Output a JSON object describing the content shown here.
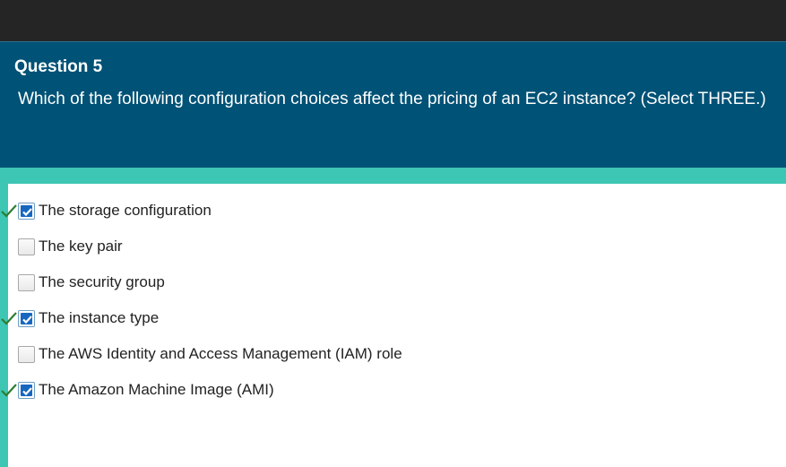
{
  "question": {
    "number_label": "Question 5",
    "text": "Which of the following configuration choices affect the pricing of an EC2 instance? (Select THREE.)"
  },
  "options": [
    {
      "label": "The storage configuration",
      "checked": true,
      "correct": true
    },
    {
      "label": "The key pair",
      "checked": false,
      "correct": false
    },
    {
      "label": "The security group",
      "checked": false,
      "correct": false
    },
    {
      "label": "The instance type",
      "checked": true,
      "correct": true
    },
    {
      "label": "The AWS Identity and Access Management (IAM) role",
      "checked": false,
      "correct": false
    },
    {
      "label": "The Amazon Machine Image (AMI)",
      "checked": true,
      "correct": true
    }
  ],
  "colors": {
    "top_bar": "#252526",
    "header_bg": "#005276",
    "accent_teal": "#3ec6b4",
    "checkbox_fill": "#1767c0",
    "correct_mark": "#2e7d32"
  }
}
